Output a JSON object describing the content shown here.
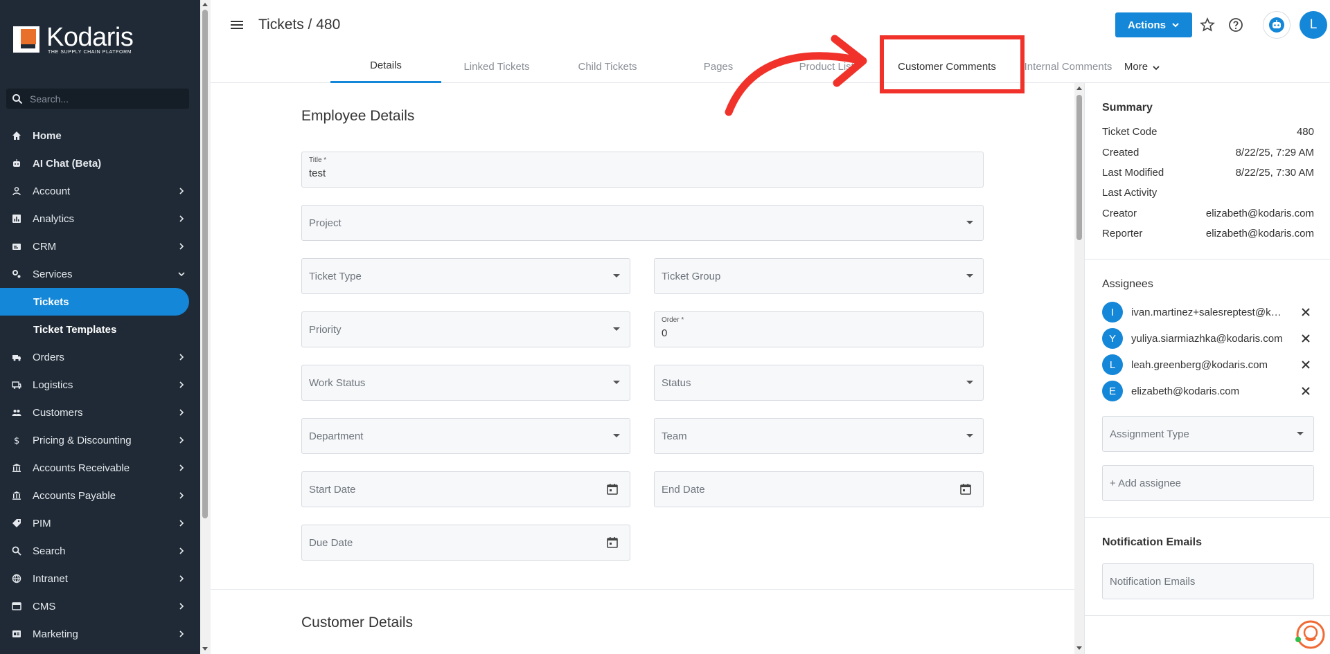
{
  "app": {
    "logo_name": "Kodaris",
    "logo_tagline": "THE SUPPLY CHAIN PLATFORM",
    "brand_color": "#1487d8",
    "sidebar_color": "#1f2a36"
  },
  "sidebar": {
    "search_placeholder": "Search...",
    "items": [
      {
        "label": "Home",
        "icon": "home-icon",
        "chevron": false
      },
      {
        "label": "AI Chat (Beta)",
        "icon": "robot-icon",
        "chevron": false
      },
      {
        "label": "Account",
        "icon": "person-icon",
        "chevron": true
      },
      {
        "label": "Analytics",
        "icon": "analytics-icon",
        "chevron": true
      },
      {
        "label": "CRM",
        "icon": "crm-icon",
        "chevron": true
      },
      {
        "label": "Services",
        "icon": "services-icon",
        "chevron": true,
        "expanded": true
      },
      {
        "label": "Orders",
        "icon": "truck-icon",
        "chevron": true
      },
      {
        "label": "Logistics",
        "icon": "logistics-icon",
        "chevron": true
      },
      {
        "label": "Customers",
        "icon": "people-icon",
        "chevron": true
      },
      {
        "label": "Pricing & Discounting",
        "icon": "dollar-icon",
        "chevron": true
      },
      {
        "label": "Accounts Receivable",
        "icon": "bank-icon",
        "chevron": true
      },
      {
        "label": "Accounts Payable",
        "icon": "bank-icon",
        "chevron": true
      },
      {
        "label": "PIM",
        "icon": "tag-icon",
        "chevron": true
      },
      {
        "label": "Search",
        "icon": "search-icon",
        "chevron": true
      },
      {
        "label": "Intranet",
        "icon": "globe-icon",
        "chevron": true
      },
      {
        "label": "CMS",
        "icon": "cms-icon",
        "chevron": true
      },
      {
        "label": "Marketing",
        "icon": "marketing-icon",
        "chevron": true
      }
    ],
    "sub_items": [
      {
        "label": "Tickets",
        "active": true
      },
      {
        "label": "Ticket Templates",
        "active": false
      }
    ]
  },
  "header": {
    "title": "Tickets / 480",
    "actions_label": "Actions",
    "user_initial": "L"
  },
  "tabs": [
    {
      "label": "Details",
      "active": true
    },
    {
      "label": "Linked Tickets",
      "active": false
    },
    {
      "label": "Child Tickets",
      "active": false
    },
    {
      "label": "Pages",
      "active": false
    },
    {
      "label": "Product Lists",
      "active": false
    },
    {
      "label": "Customer Comments",
      "active": false
    },
    {
      "label": "Internal Comments",
      "active": false
    },
    {
      "label": "More",
      "active": false
    }
  ],
  "form": {
    "section_title": "Employee Details",
    "title_label": "Title *",
    "title_value": "test",
    "project_label": "Project",
    "ticket_type_label": "Ticket Type",
    "ticket_group_label": "Ticket Group",
    "priority_label": "Priority",
    "order_label": "Order *",
    "order_value": "0",
    "work_status_label": "Work Status",
    "status_label": "Status",
    "department_label": "Department",
    "team_label": "Team",
    "start_date_label": "Start Date",
    "end_date_label": "End Date",
    "due_date_label": "Due Date",
    "customer_section_title": "Customer Details"
  },
  "summary": {
    "heading": "Summary",
    "rows": [
      {
        "key": "Ticket Code",
        "value": "480"
      },
      {
        "key": "Created",
        "value": "8/22/25, 7:29 AM"
      },
      {
        "key": "Last Modified",
        "value": "8/22/25, 7:30 AM"
      },
      {
        "key": "Last Activity",
        "value": ""
      },
      {
        "key": "Creator",
        "value": "elizabeth@kodaris.com"
      },
      {
        "key": "Reporter",
        "value": "elizabeth@kodaris.com"
      }
    ]
  },
  "assignees": {
    "heading": "Assignees",
    "list": [
      {
        "initial": "I",
        "email": "ivan.martinez+salesreptest@kodaris.com"
      },
      {
        "initial": "Y",
        "email": "yuliya.siarmiazhka@kodaris.com"
      },
      {
        "initial": "L",
        "email": "leah.greenberg@kodaris.com"
      },
      {
        "initial": "E",
        "email": "elizabeth@kodaris.com"
      }
    ],
    "assignment_type_label": "Assignment Type",
    "add_assignee_label": "+ Add assignee"
  },
  "notifications": {
    "heading": "Notification Emails",
    "field_label": "Notification Emails"
  },
  "annotation": {
    "highlight_color": "#f0322a"
  }
}
